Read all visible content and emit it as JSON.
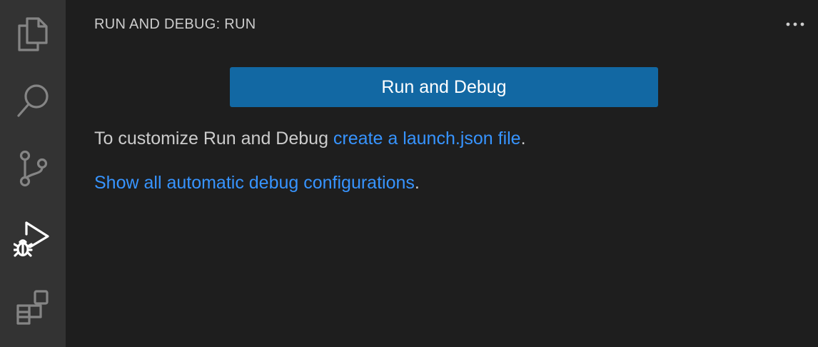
{
  "activity_bar": {
    "items": [
      {
        "name": "explorer",
        "icon": "files-icon"
      },
      {
        "name": "search",
        "icon": "search-icon"
      },
      {
        "name": "source-control",
        "icon": "source-control-icon"
      },
      {
        "name": "run-and-debug",
        "icon": "run-debug-icon",
        "active": true
      },
      {
        "name": "extensions",
        "icon": "extensions-icon"
      }
    ]
  },
  "sidebar": {
    "title": "RUN AND DEBUG: RUN",
    "more_icon": "more-horizontal-icon",
    "more_label": "···",
    "run_button_label": "Run and Debug",
    "customize_prefix": "To customize Run and Debug ",
    "customize_link": "create a launch.json file",
    "customize_suffix": ".",
    "show_all_link": "Show all automatic debug configurations",
    "show_all_suffix": "."
  },
  "colors": {
    "activity_bar_bg": "#333333",
    "sidebar_bg": "#1e1e1e",
    "button_bg": "#1268a3",
    "link": "#3794ff",
    "text": "#cccccc",
    "icon": "#858585",
    "icon_active": "#ffffff"
  }
}
